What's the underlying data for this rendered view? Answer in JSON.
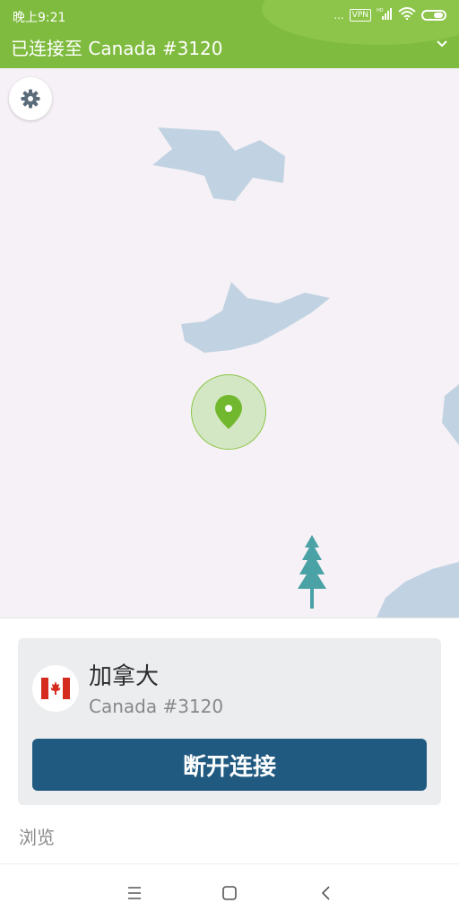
{
  "status_bar": {
    "time": "晚上9:21",
    "dots": "...",
    "vpn": "VPN",
    "hd": "HD"
  },
  "header": {
    "title": "已连接至 Canada #3120",
    "accent": "#7fbb3f"
  },
  "map": {
    "background": "#f6f1f6",
    "water": "#c1d3e2",
    "tree": "#4aa2a6"
  },
  "connection_card": {
    "country": "加拿大",
    "server": "Canada #3120",
    "disconnect_label": "断开连接",
    "button_color": "#205a80"
  },
  "browse_label": "浏览",
  "icons": [
    "settings-gear-icon",
    "location-pin-icon",
    "canada-flag-icon",
    "chevron-down-icon",
    "menu-icon",
    "home-icon",
    "back-icon"
  ]
}
